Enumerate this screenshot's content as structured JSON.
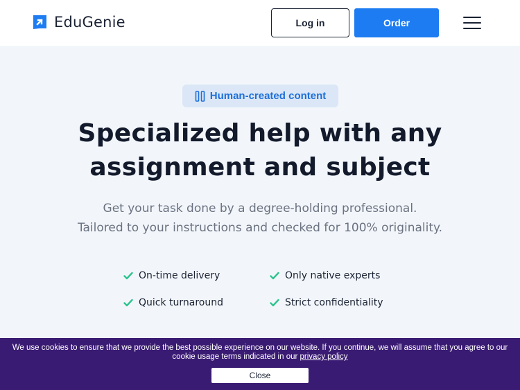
{
  "header": {
    "brand": "EduGenie",
    "login_label": "Log in",
    "order_label": "Order",
    "menu_icon": "hamburger-menu-icon"
  },
  "hero": {
    "badge": "Human-created content",
    "headline_line1": "Specialized help with any",
    "headline_line2": "assignment and subject",
    "subhead_line1": "Get your task done by a degree-holding professional.",
    "subhead_line2": "Tailored to your instructions and checked for 100% originality.",
    "features": [
      "On-time delivery",
      "Only native experts",
      "Quick turnaround",
      "Strict confidentiality"
    ]
  },
  "cookie": {
    "text_before_link": "We use cookies to ensure that we provide the best possible experience on our website. If you continue, we will assume that you agree to our cookie usage terms indicated in our ",
    "link_label": "privacy policy",
    "close_label": "Close"
  },
  "colors": {
    "accent": "#1d7cf2",
    "check": "#2fc48d",
    "cookie_bg": "#3a1b73",
    "hero_bg": "#f2f6fb"
  }
}
